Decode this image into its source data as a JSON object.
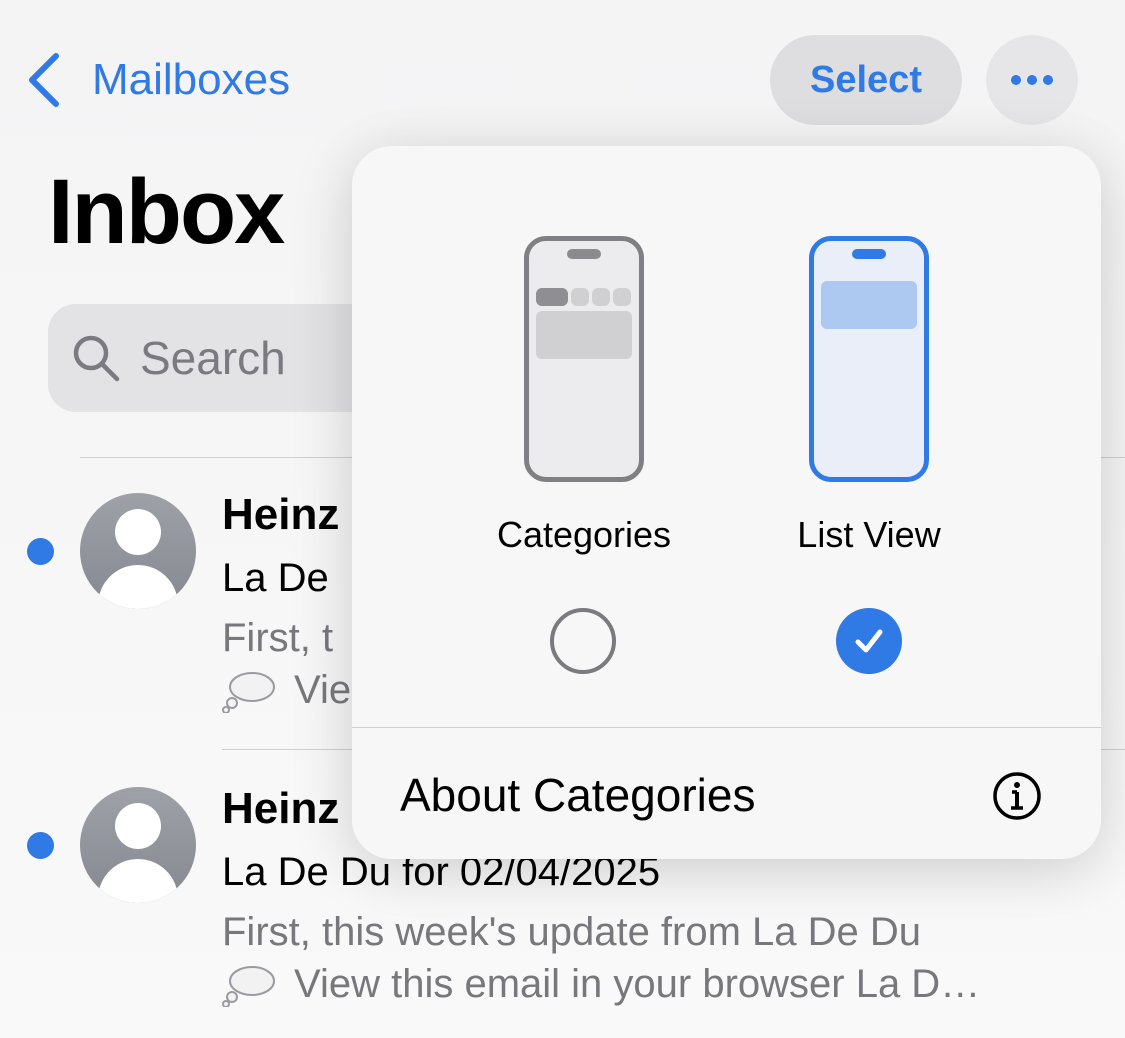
{
  "nav": {
    "back_label": "Mailboxes",
    "select_label": "Select",
    "more_icon": "ellipsis-icon"
  },
  "title": "Inbox",
  "search": {
    "placeholder": "Search"
  },
  "messages": [
    {
      "sender": "Heinz",
      "subject": "La De",
      "preview": "First, t",
      "preview_line2": "Vie",
      "unread": true
    },
    {
      "sender": "Heinz",
      "subject": "La De Du for 02/04/2025",
      "preview": "First, this week's update from La De Du",
      "preview_line2": "View this email in your browser La D…",
      "unread": true
    }
  ],
  "popover": {
    "options": [
      {
        "label": "Categories",
        "selected": false
      },
      {
        "label": "List View",
        "selected": true
      }
    ],
    "about_label": "About Categories",
    "about_icon": "info-icon"
  },
  "colors": {
    "accent": "#2f7ae5",
    "secondary_text": "#77777c"
  }
}
